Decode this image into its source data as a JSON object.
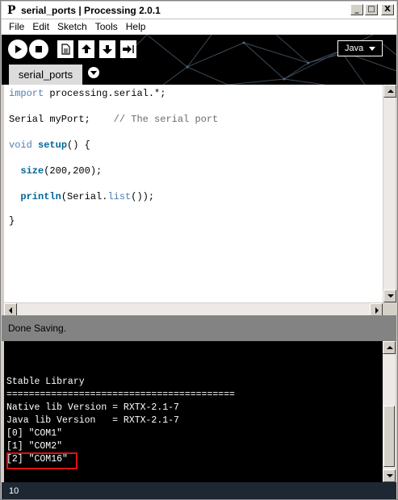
{
  "window": {
    "app_icon": "P",
    "title": "serial_ports | Processing 2.0.1",
    "controls": {
      "minimize": "_",
      "maximize": "□",
      "close": "X"
    }
  },
  "menu": [
    "File",
    "Edit",
    "Sketch",
    "Tools",
    "Help"
  ],
  "toolbar": {
    "buttons": [
      "run-icon",
      "stop-icon",
      "new-icon",
      "open-icon",
      "save-icon",
      "export-icon"
    ],
    "mode": "Java"
  },
  "tabs": [
    {
      "label": "serial_ports"
    }
  ],
  "editor": {
    "line1_kw": "import",
    "line1_rest": " processing.serial.*;",
    "line2_code": "Serial myPort;",
    "line2_comment": "// The serial port",
    "line3_kw": "void",
    "line3_fn": "setup",
    "line3_rest": "() {",
    "line4_fn": "size",
    "line4_rest": "(200,200);",
    "line5_fn": "println",
    "line5_mid": "(Serial.",
    "line5_fn2": "list",
    "line5_rest": "());",
    "line6": "}"
  },
  "status": {
    "message": "Done Saving."
  },
  "console": {
    "lines": [
      "Stable Library",
      "=========================================",
      "Native lib Version = RXTX-2.1-7",
      "Java lib Version   = RXTX-2.1-7",
      "[0] \"COM1\"",
      "[1] \"COM2\"",
      "[2] \"COM16\""
    ]
  },
  "line_number": "10",
  "colors": {
    "toolbar_bg": "#000000",
    "status_bg": "#838383",
    "console_bg": "#000000",
    "keyword": "#4f7db3",
    "function": "#006699",
    "highlight": "#e01010",
    "linebar_bg": "#1e2832"
  }
}
